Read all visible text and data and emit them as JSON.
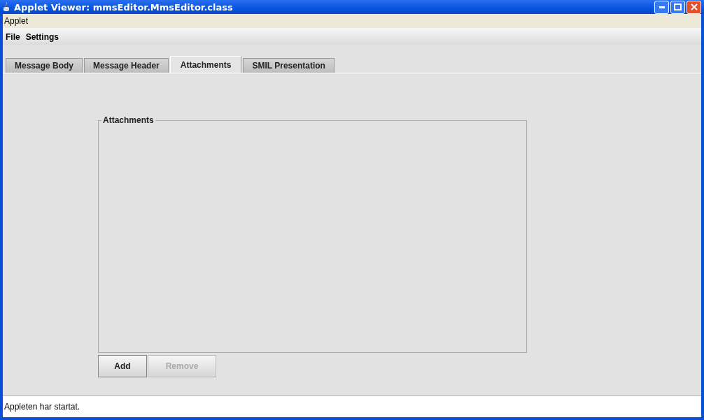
{
  "window": {
    "title": "Applet Viewer: mmsEditor.MmsEditor.class"
  },
  "applet_menu": [
    "Applet"
  ],
  "menu_bar": [
    "File",
    "Settings"
  ],
  "tabs": [
    {
      "label": "Message Body",
      "selected": false
    },
    {
      "label": "Message Header",
      "selected": false
    },
    {
      "label": "Attachments",
      "selected": true
    },
    {
      "label": "SMIL Presentation",
      "selected": false
    }
  ],
  "attachments_group": {
    "title": "Attachments"
  },
  "buttons": [
    {
      "label": "Add",
      "disabled": false
    },
    {
      "label": "Remove",
      "disabled": true
    }
  ],
  "status_bar": "Appleten har startat."
}
